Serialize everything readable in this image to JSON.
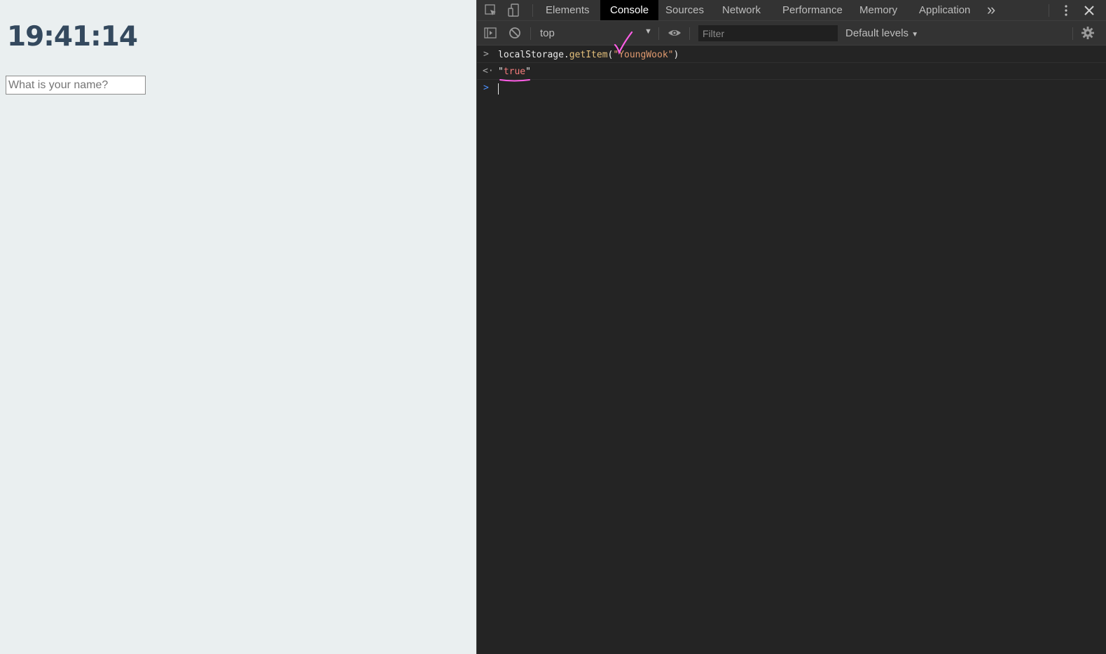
{
  "page": {
    "clock": "19:41:14",
    "name_placeholder": "What is your name?",
    "clock_color": "#34495e"
  },
  "devtools": {
    "tabs": [
      "Elements",
      "Console",
      "Sources",
      "Network",
      "Performance",
      "Memory",
      "Application"
    ],
    "active_tab": "Console",
    "more_tabs_glyph": "»",
    "context": "top",
    "filter_placeholder": "Filter",
    "levels_label": "Default levels",
    "levels_arrow": "▼",
    "context_arrow": "▼",
    "console": {
      "input_prompt": ">",
      "result_prompt": "<·",
      "command": {
        "object": "localStorage",
        "dot": ".",
        "method": "getItem",
        "open": "(",
        "arg": "\"YoungWook\"",
        "close": ")"
      },
      "result": {
        "quote_open": "\"",
        "value": "true",
        "quote_close": "\""
      },
      "active_prompt": ">"
    },
    "colors": {
      "background": "#242424",
      "toolbar": "#333333",
      "active_tab_bg": "#000000",
      "string": "#e09a6f",
      "method": "#e5c07b",
      "result_string": "#f57c7c",
      "prompt_active": "#4d90fe",
      "annotation": "#ff5ee6"
    },
    "icons": [
      "inspect-element-icon",
      "device-toolbar-icon",
      "more-tabs-icon",
      "kebab-menu-icon",
      "close-icon",
      "sidebar-toggle-icon",
      "clear-console-icon",
      "eye-icon",
      "gear-icon"
    ]
  }
}
